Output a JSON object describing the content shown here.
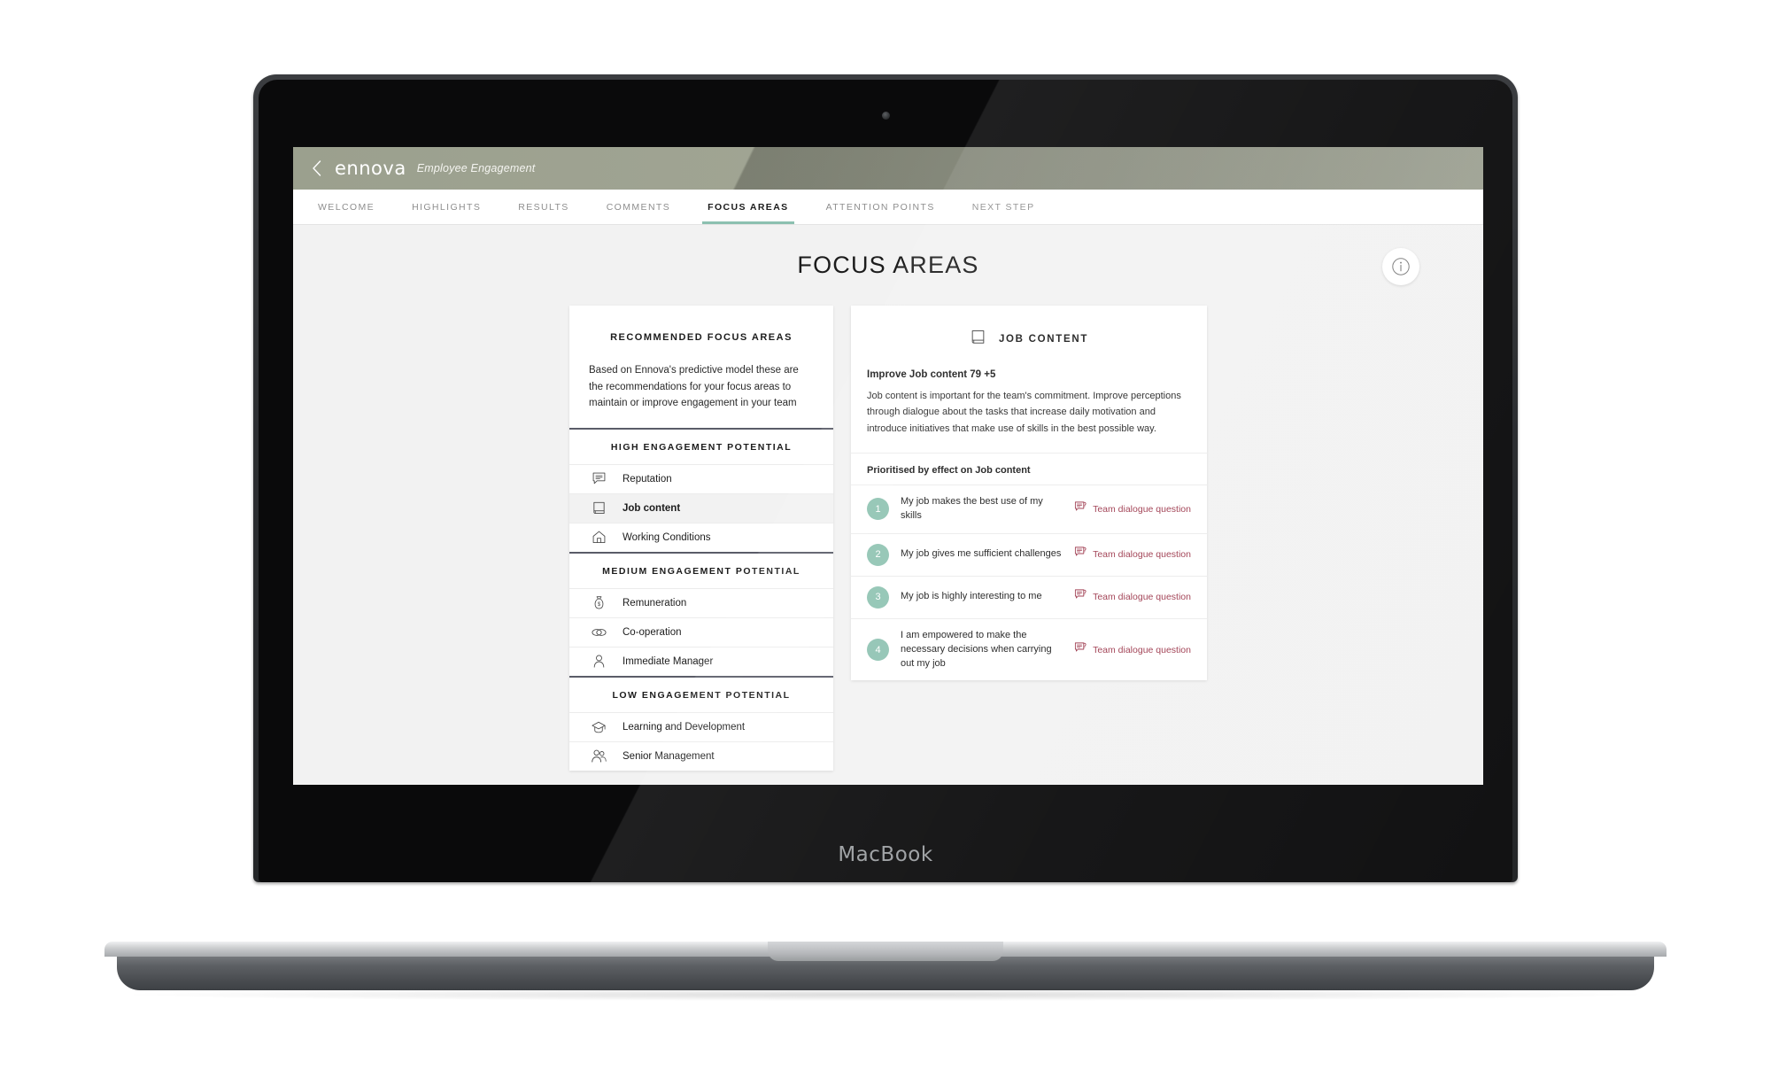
{
  "device": {
    "label": "MacBook"
  },
  "header": {
    "back_icon": "chevron-left-icon",
    "brand": "ennova",
    "subtitle": "Employee Engagement"
  },
  "nav": {
    "tabs": [
      {
        "label": "WELCOME",
        "active": false
      },
      {
        "label": "HIGHLIGHTS",
        "active": false
      },
      {
        "label": "RESULTS",
        "active": false
      },
      {
        "label": "COMMENTS",
        "active": false
      },
      {
        "label": "FOCUS AREAS",
        "active": true
      },
      {
        "label": "ATTENTION POINTS",
        "active": false
      },
      {
        "label": "NEXT STEP",
        "active": false
      }
    ]
  },
  "page": {
    "title": "FOCUS AREAS",
    "info_icon": "info-icon"
  },
  "left_panel": {
    "heading": "RECOMMENDED FOCUS AREAS",
    "description": "Based on Ennova's predictive model these are the recommendations for your focus areas to maintain or improve engagement in your team",
    "groups": [
      {
        "heading": "HIGH ENGAGEMENT POTENTIAL",
        "items": [
          {
            "label": "Reputation",
            "icon": "speech-bubble-icon",
            "selected": false
          },
          {
            "label": "Job content",
            "icon": "book-icon",
            "selected": true
          },
          {
            "label": "Working Conditions",
            "icon": "house-icon",
            "selected": false
          }
        ]
      },
      {
        "heading": "MEDIUM ENGAGEMENT POTENTIAL",
        "items": [
          {
            "label": "Remuneration",
            "icon": "money-bag-icon",
            "selected": false
          },
          {
            "label": "Co-operation",
            "icon": "linked-rings-icon",
            "selected": false
          },
          {
            "label": "Immediate Manager",
            "icon": "person-icon",
            "selected": false
          }
        ]
      },
      {
        "heading": "LOW ENGAGEMENT POTENTIAL",
        "items": [
          {
            "label": "Learning and Development",
            "icon": "graduation-cap-icon",
            "selected": false
          },
          {
            "label": "Senior Management",
            "icon": "people-group-icon",
            "selected": false
          }
        ]
      }
    ]
  },
  "right_panel": {
    "icon": "book-icon",
    "title": "JOB CONTENT",
    "improve_line": "Improve Job content 79 +5",
    "description": "Job content is important for the team's commitment. Improve perceptions through dialogue about the tasks that increase daily motivation and introduce initiatives that make use of skills in the best possible way.",
    "prioritised_heading": "Prioritised by effect on Job content",
    "questions": [
      {
        "number": "1",
        "text": "My job makes the best use of my skills",
        "link_label": "Team dialogue question",
        "link_icon": "dialogue-question-icon"
      },
      {
        "number": "2",
        "text": "My job gives me sufficient challenges",
        "link_label": "Team dialogue question",
        "link_icon": "dialogue-question-icon"
      },
      {
        "number": "3",
        "text": "My job is highly interesting to me",
        "link_label": "Team dialogue question",
        "link_icon": "dialogue-question-icon"
      },
      {
        "number": "4",
        "text": "I am empowered to make the necessary decisions when carrying out my job",
        "link_label": "Team dialogue question",
        "link_icon": "dialogue-question-icon"
      }
    ]
  },
  "colors": {
    "header_green": "#a0a493",
    "accent_teal": "#8cc0b0",
    "number_circle": "#8fc3b2",
    "link_maroon": "#9e3a4e",
    "divider_dark": "#5a5c68",
    "page_bg": "#f2f2f2"
  }
}
